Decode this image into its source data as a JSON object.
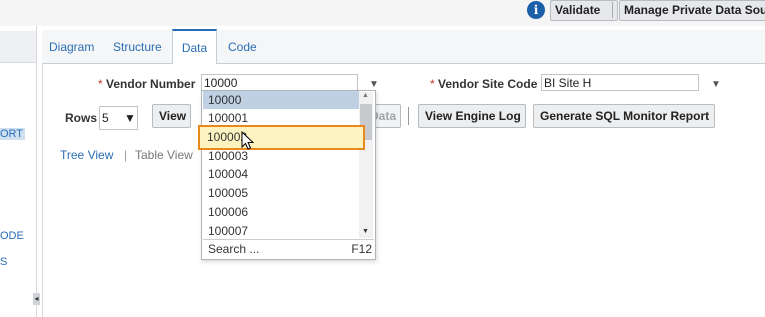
{
  "toolbar": {
    "info_icon": "i",
    "validate_label": "Validate",
    "manage_label": "Manage Private Data Sou"
  },
  "left_panel": {
    "items": [
      "ORT",
      "ODE",
      "S"
    ],
    "collapse_icon": "◂"
  },
  "tabs": [
    "Diagram",
    "Structure",
    "Data",
    "Code"
  ],
  "active_tab": "Data",
  "params": {
    "vendor_number_label": "Vendor Number",
    "vendor_number_value": "10000",
    "vendor_site_label": "Vendor Site Code",
    "vendor_site_value": "BI Site H",
    "required_marker": "*"
  },
  "rows": {
    "label": "Rows",
    "value": "5"
  },
  "buttons": {
    "view": "View",
    "data_partial": "Data",
    "view_engine_log": "View Engine Log",
    "generate_sql": "Generate SQL Monitor Report"
  },
  "view_toggle": {
    "tree": "Tree View",
    "separator": "|",
    "table": "Table View"
  },
  "dropdown": {
    "items": [
      "10000",
      "100001",
      "100002",
      "100003",
      "100004",
      "100005",
      "100006",
      "100007"
    ],
    "selected": "10000",
    "hovered": "100002",
    "search_label": "Search ...",
    "search_shortcut": "F12"
  }
}
